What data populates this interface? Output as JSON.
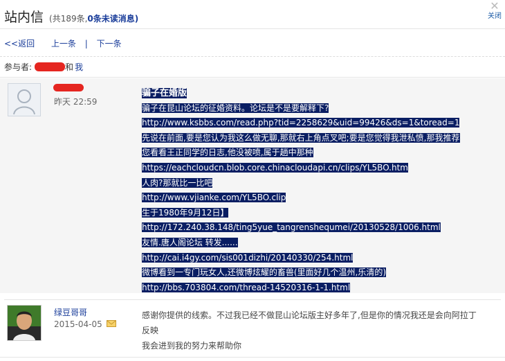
{
  "header": {
    "title": "站内信",
    "count_prefix": "(共189条,",
    "unread_count": "0",
    "unread_suffix": "条未读消息)",
    "close_label": "关闭"
  },
  "nav": {
    "back": "<<返回",
    "prev": "上一条",
    "sep": "|",
    "next": "下一条"
  },
  "participants": {
    "label": "参与者:",
    "and": "和",
    "me": "我"
  },
  "message1": {
    "time": "昨天 22:59",
    "title": "骗子在婚版",
    "lines": [
      "骗子在昆山论坛的征婚资料。论坛是不是要解释下?",
      "http://www.ksbbs.com/read.php?tid=2258629&uid=99426&ds=1&toread=1",
      "先说在前面,要是您认为我这么做无聊,那就右上角点叉吧;要是您觉得我泄私愤,那我推荐",
      "您看看王正同学的日志,他没被喷,属于趟中那种",
      "https://eachcloudcn.blob.core.chinacloudapi.cn/clips/YL5BO.htm",
      "人肉?那就比一比吧",
      "http://www.vjianke.com/YL5BO.clip",
      "生于1980年9月12日】",
      "http://172.240.38.148/ting5yue_tangrenshequmei/20130528/1006.html",
      "友情.唐人阁论坛 转发......",
      "http://cai.i4gy.com/sis001dizhi/20140330/254.html",
      "微博看到一专门玩女人,还微博炫耀的畜兽(里面好几个温州,乐清的)",
      "http://bbs.703804.com/thread-14520316-1-1.html"
    ]
  },
  "message2": {
    "sender": "绿豆哥哥",
    "time": "2015-04-05",
    "lines": [
      "感谢你提供的线索。不过我已经不做昆山论坛版主好多年了,但是你的情况我还是会向阿拉丁",
      "反映",
      "我会进到我的努力来帮助你"
    ]
  },
  "icons": {
    "close": "close-icon",
    "mail": "mail-icon",
    "avatar": "default-avatar-icon"
  },
  "colors": {
    "link": "#1a3d9a",
    "highlight": "#0a1e63",
    "redaction": "#e52620"
  }
}
